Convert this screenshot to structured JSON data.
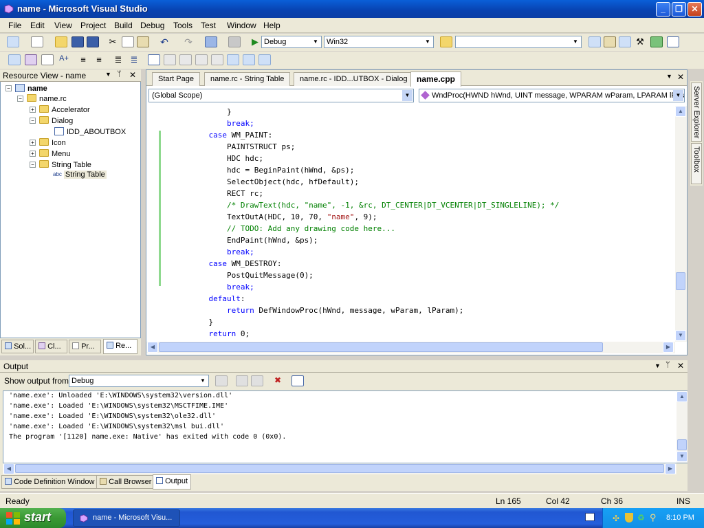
{
  "window": {
    "title": "name - Microsoft Visual Studio",
    "controls": [
      "minimize",
      "maximize",
      "close"
    ]
  },
  "menu": [
    "File",
    "Edit",
    "View",
    "Project",
    "Build",
    "Debug",
    "Tools",
    "Test",
    "Window",
    "Help"
  ],
  "toolbar": {
    "config": "Debug",
    "platform": "Win32",
    "find": ""
  },
  "resource_view": {
    "title": "Resource View - name",
    "items": [
      {
        "label": "name",
        "bold": true,
        "icon": "project-icon"
      },
      {
        "label": "name.rc",
        "icon": "folder-icon"
      },
      {
        "label": "Accelerator",
        "icon": "folder-icon"
      },
      {
        "label": "Dialog",
        "icon": "folder-icon"
      },
      {
        "label": "IDD_ABOUTBOX",
        "icon": "dialog-icon"
      },
      {
        "label": "Icon",
        "icon": "folder-icon"
      },
      {
        "label": "Menu",
        "icon": "folder-icon"
      },
      {
        "label": "String Table",
        "icon": "folder-icon"
      },
      {
        "label": "String Table",
        "icon": "string-table-icon"
      }
    ],
    "bottom_tabs": [
      "Sol...",
      "Cl...",
      "Pr...",
      "Re..."
    ]
  },
  "editor": {
    "tabs": [
      "Start Page",
      "name.rc - String Table",
      "name.rc - IDD...UTBOX - Dialog",
      "name.cpp"
    ],
    "active_tab": "name.cpp",
    "scope": "(Global Scope)",
    "function": "WndProc(HWND hWnd, UINT message, WPARAM wParam, LPARAM lPara",
    "lines": [
      "        }",
      "        break;",
      "    case WM_PAINT:",
      "        PAINTSTRUCT ps;",
      "        HDC hdc;",
      "        hdc = BeginPaint(hWnd, &ps);",
      "        SelectObject(hdc, hfDefault);",
      "        RECT rc;",
      "        /* DrawText(hdc, \"name\", -1, &rc, DT_CENTER|DT_VCENTER|DT_SINGLELINE); */",
      "        TextOutA(HDC, 10, 70, \"name\", 9);",
      "        // TODO: Add any drawing code here...",
      "        EndPaint(hWnd, &ps);",
      "        break;",
      "    case WM_DESTROY:",
      "        PostQuitMessage(0);",
      "        break;",
      "    default:",
      "        return DefWindowProc(hWnd, message, wParam, lParam);",
      "    }",
      "    return 0;"
    ]
  },
  "side_tabs": [
    "Server Explorer",
    "Toolbox"
  ],
  "output": {
    "title": "Output",
    "show_from_label": "Show output from:",
    "show_from_value": "Debug",
    "lines": [
      "'name.exe': Unloaded 'E:\\WINDOWS\\system32\\version.dll'",
      "'name.exe': Loaded 'E:\\WINDOWS\\system32\\MSCTFIME.IME'",
      "'name.exe': Loaded 'E:\\WINDOWS\\system32\\ole32.dll'",
      "'name.exe': Loaded 'E:\\WINDOWS\\system32\\msl bui.dll'",
      "The program '[1120] name.exe: Native' has exited with code 0 (0x0)."
    ],
    "bottom_tabs": [
      "Code Definition Window",
      "Call Browser",
      "Output"
    ]
  },
  "status": {
    "ready": "Ready",
    "ln": "Ln 165",
    "col": "Col 42",
    "ch": "Ch 36",
    "mode": "INS"
  },
  "taskbar": {
    "start": "start",
    "item": "name - Microsoft Visu...",
    "clock": "8:10 PM"
  },
  "colors": {
    "keyword": "#0000ff",
    "comment": "#008000",
    "string": "#a31515"
  }
}
